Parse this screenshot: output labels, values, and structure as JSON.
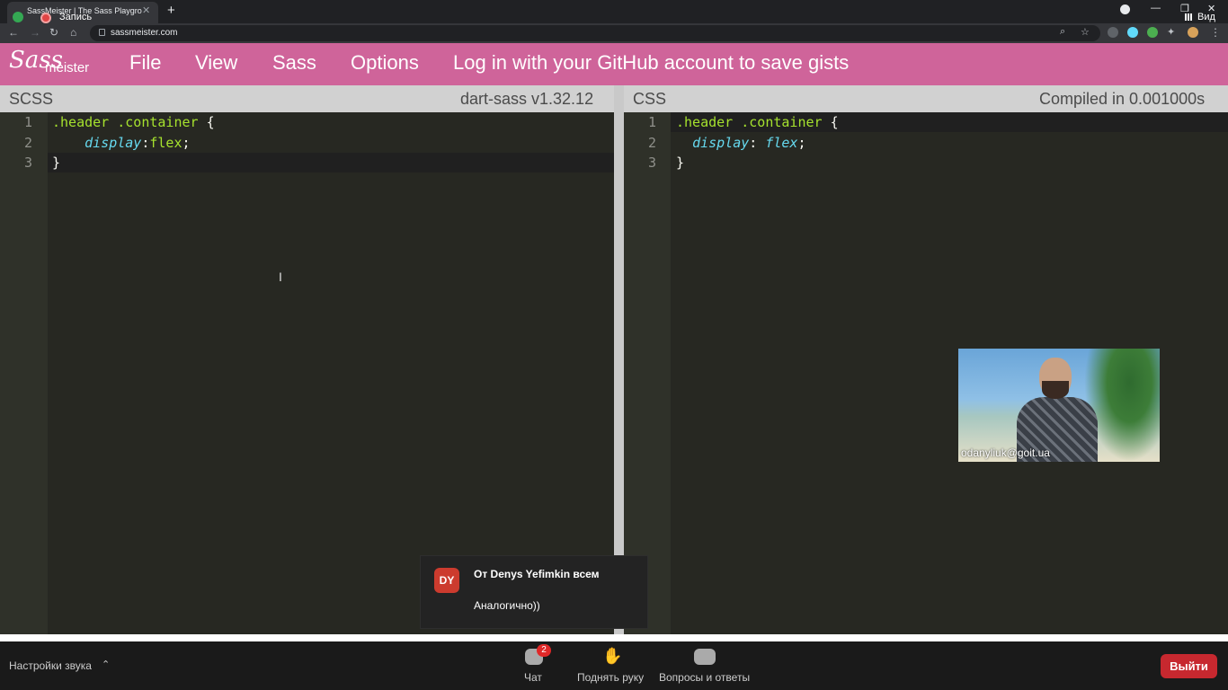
{
  "browser": {
    "tab_title": "SassMeister | The Sass Playground",
    "recording_label": "Запись",
    "view_label": "Вид",
    "url": "sassmeister.com"
  },
  "sassmeister": {
    "logo_script": "Sass",
    "logo_suffix": "meister",
    "menu": [
      "File",
      "View",
      "Sass",
      "Options",
      "Log in with your GitHub account to save gists"
    ]
  },
  "scss_panel": {
    "label": "SCSS",
    "version": "dart-sass v1.32.12",
    "line_numbers": [
      "1",
      "2",
      "3"
    ],
    "lines": [
      [
        {
          "t": ".header .container",
          "c": "sel"
        },
        {
          "t": " {",
          "c": ""
        }
      ],
      [
        {
          "t": "    ",
          "c": ""
        },
        {
          "t": "display",
          "c": "prop"
        },
        {
          "t": ":",
          "c": ""
        },
        {
          "t": "flex",
          "c": "sel"
        },
        {
          "t": ";",
          "c": ""
        }
      ],
      [
        {
          "t": "}",
          "c": ""
        }
      ]
    ]
  },
  "css_panel": {
    "label": "CSS",
    "compile_status": "Compiled in 0.001000s",
    "line_numbers": [
      "1",
      "2",
      "3"
    ],
    "lines": [
      [
        {
          "t": ".header .container",
          "c": "sel"
        },
        {
          "t": " {",
          "c": ""
        }
      ],
      [
        {
          "t": "  ",
          "c": ""
        },
        {
          "t": "display",
          "c": "prop"
        },
        {
          "t": ": ",
          "c": ""
        },
        {
          "t": "flex",
          "c": "prop"
        },
        {
          "t": ";",
          "c": ""
        }
      ],
      [
        {
          "t": "}",
          "c": ""
        }
      ]
    ]
  },
  "video": {
    "participant_name": "odanyliuk@goit.ua"
  },
  "chat_notification": {
    "avatar_initials": "DY",
    "from": "От Denys Yefimkin всем",
    "message": "Аналогично))"
  },
  "zoom_bar": {
    "audio_settings": "Настройки звука",
    "chat_label": "Чат",
    "chat_badge": "2",
    "raise_hand_label": "Поднять руку",
    "qa_label": "Вопросы и ответы",
    "leave_label": "Выйти"
  },
  "colors": {
    "brand_pink": "#cf649a",
    "editor_bg": "#272822",
    "leave_red": "#c7282f"
  }
}
